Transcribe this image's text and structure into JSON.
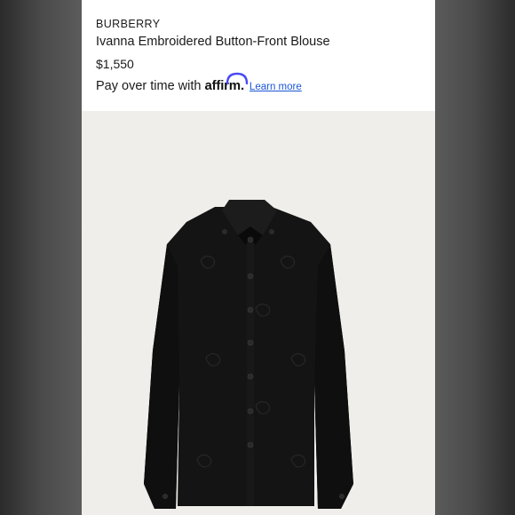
{
  "listing": {
    "brand": "BURBERRY",
    "title": "Ivanna Embroidered Button-Front Blouse",
    "price": "$1,550",
    "financing": {
      "prefix": "Pay over time with",
      "provider_logo": "affirm",
      "provider_suffix": ".",
      "link_label": "Learn more"
    }
  },
  "colors": {
    "shirt": "#141414",
    "link": "#1a56d6",
    "affirm_arc": "#4a4af4",
    "photo_background": "#efeeea"
  },
  "icons": {
    "affirm": "affirm-arc-logo"
  }
}
